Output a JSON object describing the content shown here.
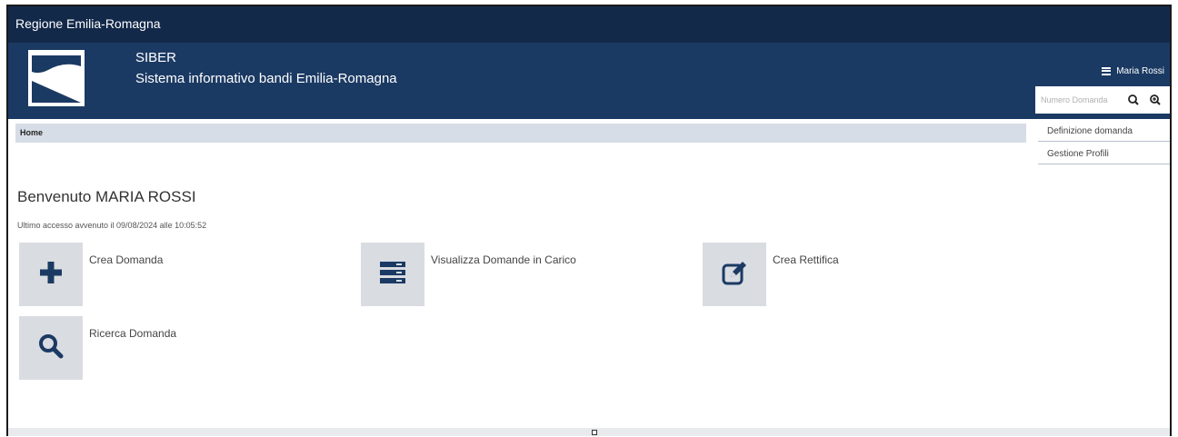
{
  "topbar": {
    "region_name": "Regione Emilia-Romagna"
  },
  "header": {
    "app_title": "SIBER",
    "app_subtitle": "Sistema informativo bandi Emilia-Romagna",
    "user_name": "Maria Rossi",
    "search_placeholder": "Numero Domanda"
  },
  "breadcrumb": {
    "home": "Home"
  },
  "side_menu": {
    "items": [
      {
        "label": "Definizione domanda"
      },
      {
        "label": "Gestione Profili"
      }
    ]
  },
  "main": {
    "welcome": "Benvenuto MARIA ROSSI",
    "last_access": "Ultimo accesso avvenuto il 09/08/2024 alle 10:05:52",
    "actions": [
      {
        "label": "Crea Domanda",
        "icon": "plus-icon"
      },
      {
        "label": "Visualizza Domande in Carico",
        "icon": "list-icon"
      },
      {
        "label": "Crea Rettifica",
        "icon": "edit-icon"
      },
      {
        "label": "Ricerca Domanda",
        "icon": "search-icon"
      }
    ]
  },
  "colors": {
    "topbar_bg": "#13294a",
    "header_bg": "#1b3a63",
    "breadcrumb_bg": "#d7dde7",
    "tile_bg": "#d9dce1",
    "icon_color": "#1b3a63"
  }
}
